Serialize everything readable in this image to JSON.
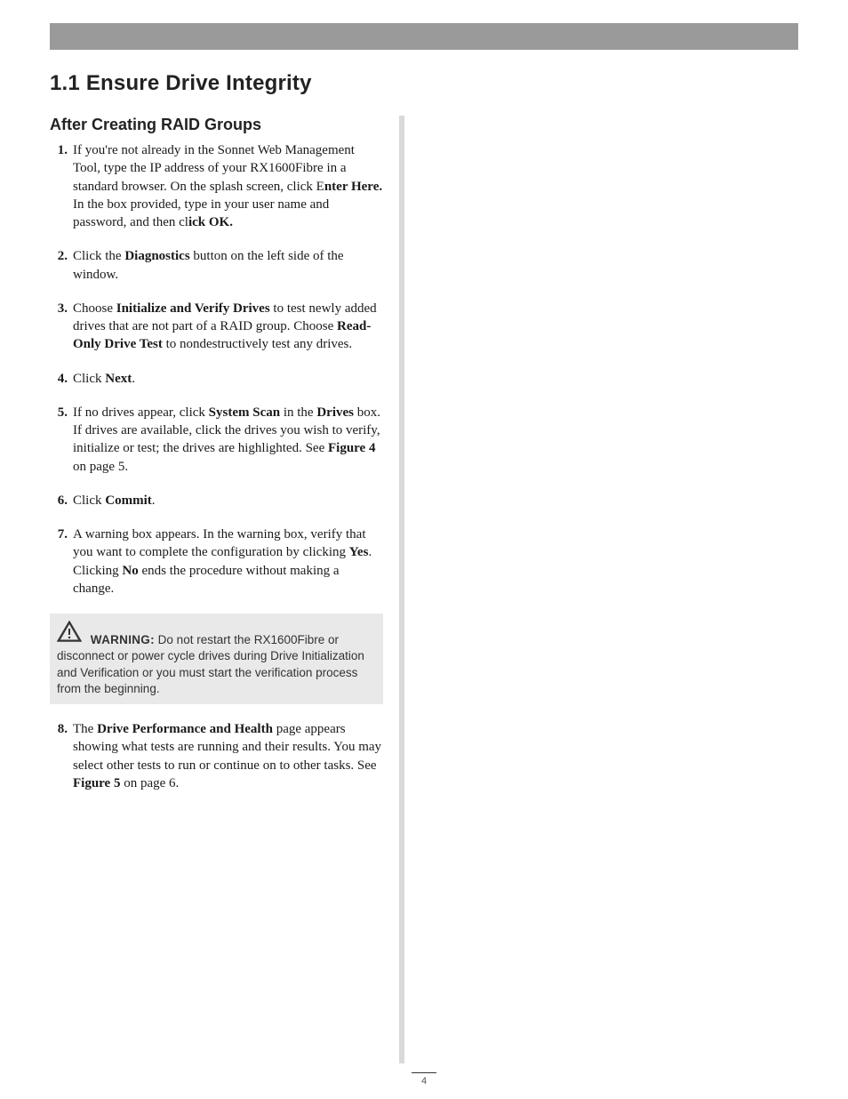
{
  "section": {
    "title": "1.1 Ensure Drive Integrity",
    "subtitle": "After Creating RAID Groups"
  },
  "steps": {
    "s1": {
      "num": "1.",
      "t1": "If you're not already in the Sonnet Web Management Tool, type the IP address of your RX1600Fibre in a standard browser. On the splash screen, click E",
      "b1": "nter Here.",
      "t2": " In the box provided, type in your user name and password, and then cl",
      "b2": "ick OK."
    },
    "s2": {
      "num": "2.",
      "t1": "Click the ",
      "b1": "Diagnostics",
      "t2": " button on the left side of the window."
    },
    "s3": {
      "num": "3.",
      "t1": "Choose ",
      "b1": "Initialize and Verify Drives",
      "t2": " to test newly added drives that are not part of a RAID group. Choose ",
      "b2": "Read-Only Drive Test",
      "t3": " to nondestructively test any drives."
    },
    "s4": {
      "num": "4.",
      "t1": "Click ",
      "b1": "Next",
      "t2": "."
    },
    "s5": {
      "num": "5.",
      "t1": "If no drives appear, click ",
      "b1": "System Scan",
      "t2": " in the ",
      "b2": "Drives",
      "t3": " box. If drives are available, click the drives you wish to verify, initialize or test; the drives are highlighted. See ",
      "b3": "Figure 4",
      "t4": " on page 5."
    },
    "s6": {
      "num": "6.",
      "t1": "Click ",
      "b1": "Commit",
      "t2": "."
    },
    "s7": {
      "num": "7.",
      "t1": "A warning box appears. In the warning box, verify that you want to complete the configuration by clicking ",
      "b1": "Yes",
      "t2": ". Clicking ",
      "b2": "No",
      "t3": " ends the procedure without making a change."
    },
    "s8": {
      "num": "8.",
      "t1": "The ",
      "b1": "Drive Performance and Health",
      "t2": " page appears showing what tests are running and their results. You may select other tests to run or continue on to other tasks. See ",
      "b2": "Figure 5",
      "t3": " on page 6."
    }
  },
  "warning": {
    "label": "WARNING:",
    "text": " Do not restart the RX1600Fibre or disconnect or power cycle drives during Drive Initialization and Verification or you must start the verification process from the beginning."
  },
  "pageNumber": "4"
}
